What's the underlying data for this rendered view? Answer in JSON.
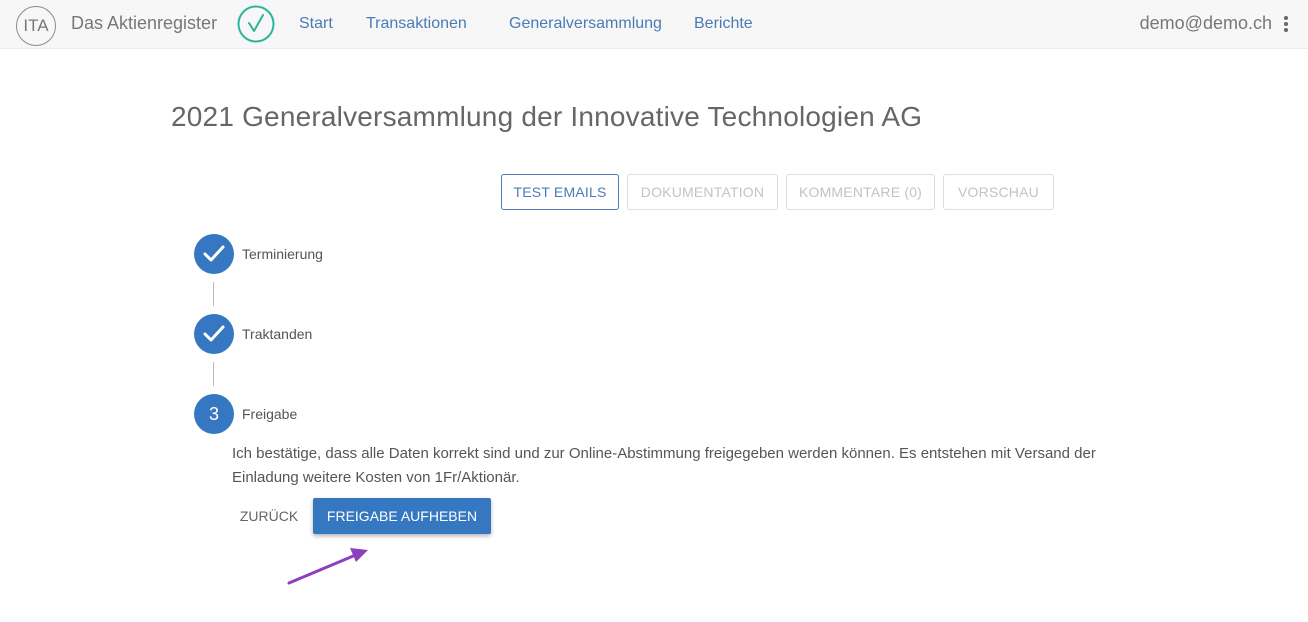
{
  "nav": {
    "logo_text": "ITA",
    "brand": "Das Aktienregister",
    "links": [
      "Start",
      "Transaktionen",
      "Generalversammlung",
      "Berichte"
    ],
    "user": "demo@demo.ch"
  },
  "page": {
    "title": "2021 Generalversammlung der Innovative Technologien AG"
  },
  "toolbar": {
    "buttons": [
      "TEST EMAILS",
      "DOKUMENTATION",
      "KOMMENTARE (0)",
      "VORSCHAU"
    ]
  },
  "steps": [
    {
      "label": "Terminierung",
      "status": "done"
    },
    {
      "label": "Traktanden",
      "status": "done"
    },
    {
      "label": "Freigabe",
      "status": "active",
      "number": "3"
    }
  ],
  "freigabe": {
    "description": "Ich bestätige, dass alle Daten korrekt sind und zur Online-Abstimmung freigegeben werden können. Es entstehen mit Versand der Einladung weitere Kosten von 1Fr/Aktionär.",
    "back_label": "ZURÜCK",
    "primary_label": "FREIGABE AUFHEBEN"
  },
  "colors": {
    "primary": "#3578c1",
    "nav_link": "#4a7bb7",
    "check_green": "#2bb59a",
    "annotation_arrow": "#8e3fbf"
  }
}
